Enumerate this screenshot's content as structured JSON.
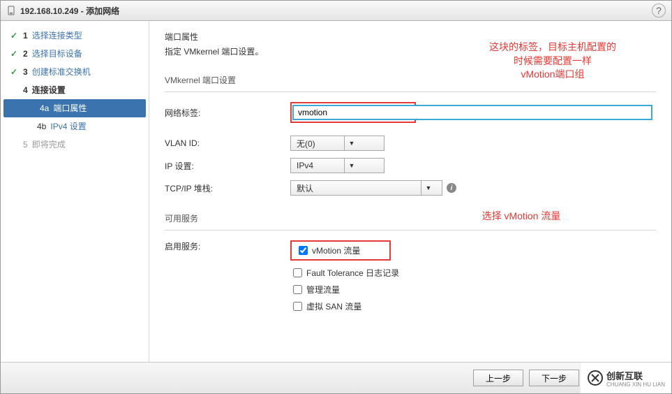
{
  "titlebar": {
    "title": "192.168.10.249 - 添加网络"
  },
  "sidebar": {
    "steps": [
      {
        "num": "1",
        "label": "选择连接类型"
      },
      {
        "num": "2",
        "label": "选择目标设备"
      },
      {
        "num": "3",
        "label": "创建标准交换机"
      },
      {
        "num": "4",
        "label": "连接设置"
      },
      {
        "num": "4a",
        "label": "端口属性"
      },
      {
        "num": "4b",
        "label": "IPv4 设置"
      },
      {
        "num": "5",
        "label": "即将完成"
      }
    ]
  },
  "content": {
    "header_title": "端口属性",
    "header_desc": "指定 VMkernel 端口设置。",
    "group1_heading": "VMkernel 端口设置",
    "labels": {
      "network_label": "网络标签:",
      "vlan_id": "VLAN ID:",
      "ip_settings": "IP 设置:",
      "tcpip_stack": "TCP/IP 堆栈:"
    },
    "values": {
      "network_label": "vmotion",
      "vlan_id": "无(0)",
      "ip_settings": "IPv4",
      "tcpip_stack": "默认"
    },
    "group2_heading": "可用服务",
    "enable_services_label": "启用服务:",
    "services": {
      "vmotion": "vMotion 流量",
      "fault_tolerance": "Fault Tolerance 日志记录",
      "management": "管理流量",
      "vsan": "虚拟 SAN 流量"
    }
  },
  "annotations": {
    "a1_line1": "这块的标签，目标主机配置的",
    "a1_line2": "时候需要配置一样",
    "a1_line3": "vMotion端口组",
    "a2": "选择 vMotion 流量"
  },
  "footer": {
    "prev": "上一步",
    "next": "下一步"
  },
  "watermark": {
    "title": "创新互联",
    "sub": "CHUANG XIN HU LIAN"
  }
}
